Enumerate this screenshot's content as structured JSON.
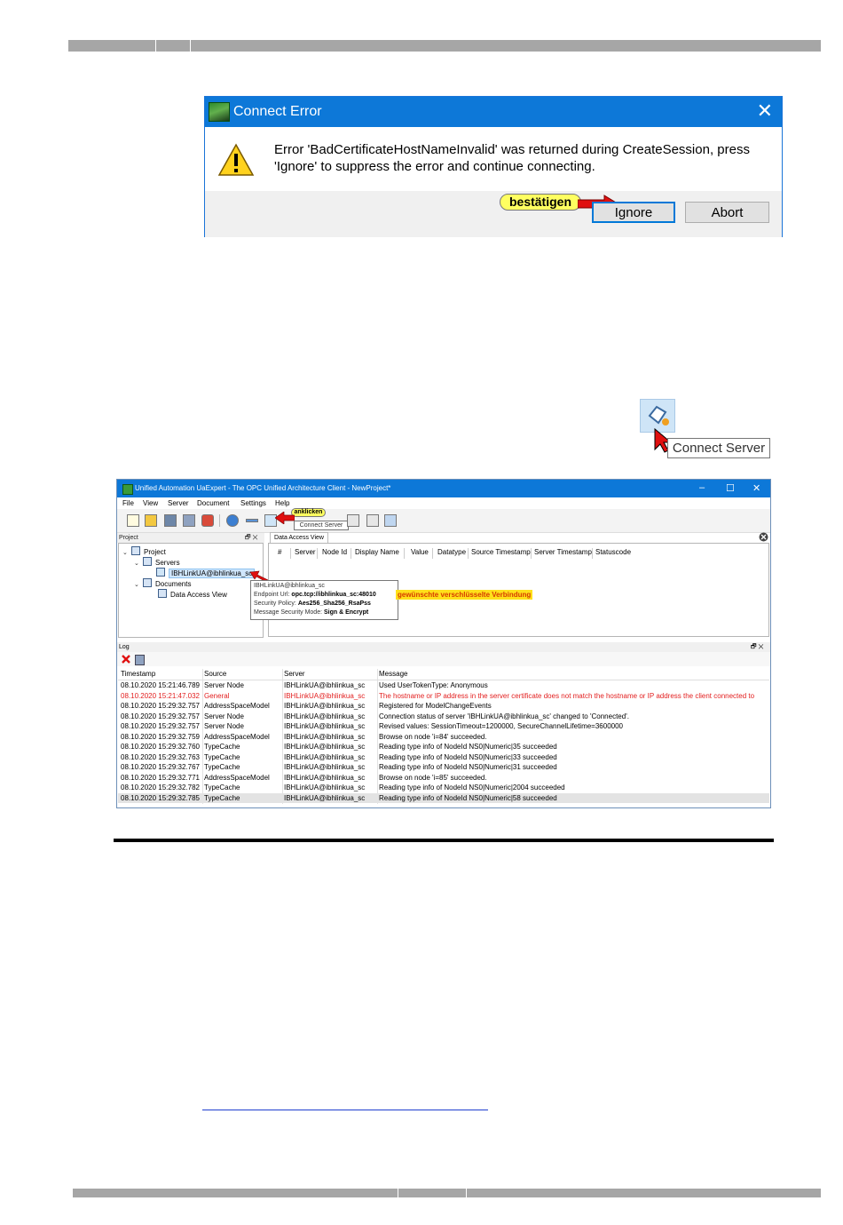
{
  "dialog": {
    "title": "Connect Error",
    "close_glyph": "✕",
    "message_line1": "Error 'BadCertificateHostNameInvalid' was returned during CreateSession, press",
    "message_line2": "'Ignore' to suppress the error and continue connecting.",
    "callout": "bestätigen",
    "ignore_label": "Ignore",
    "abort_label": "Abort"
  },
  "connect_server_tooltip": "Connect Server",
  "window": {
    "title": "Unified Automation UaExpert - The OPC Unified Architecture Client - NewProject*",
    "controls": {
      "min": "–",
      "max": "☐",
      "close": "✕"
    },
    "menu": [
      "File",
      "View",
      "Server",
      "Document",
      "Settings",
      "Help"
    ],
    "toolbar_callout": "anklicken",
    "toolbar_tooltip": "Connect Server",
    "project_pane": {
      "header": "Project",
      "header_controls": "🗗 ✕",
      "tree": {
        "project": "Project",
        "servers": "Servers",
        "server_item": "IBHLinkUA@ibhlinkua_sc",
        "documents": "Documents",
        "data_access_view": "Data Access View"
      }
    },
    "dav": {
      "tab": "Data Access View",
      "columns": [
        "#",
        "Server",
        "Node Id",
        "Display Name",
        "Value",
        "Datatype",
        "Source Timestamp",
        "Server Timestamp",
        "Statuscode"
      ]
    },
    "server_tooltip": {
      "name": "IBHLinkUA@ibhlinkua_sc",
      "endpoint_label": "Endpoint Url:",
      "endpoint": "opc.tcp://ibhlinkua_sc:48010",
      "policy_label": "Security Policy:",
      "policy": "Aes256_Sha256_RsaPss",
      "mode_label": "Message Security Mode:",
      "mode": "Sign & Encrypt",
      "callout": "gewünschte verschlüsselte Verbindung"
    },
    "log": {
      "header": "Log",
      "header_controls": "🗗 ✕",
      "columns": [
        "Timestamp",
        "Source",
        "Server",
        "Message"
      ],
      "rows": [
        {
          "t": "08.10.2020 15:21:46.789",
          "s": "Server Node",
          "srv": "IBHLinkUA@ibhlinkua_sc",
          "m": "Used UserTokenType: Anonymous"
        },
        {
          "t": "08.10.2020 15:21:47.032",
          "s": "General",
          "srv": "IBHLinkUA@ibhlinkua_sc",
          "m": "The hostname or IP address in the server certificate does not match the hostname or IP address the client connected to"
        },
        {
          "t": "08.10.2020 15:29:32.757",
          "s": "AddressSpaceModel",
          "srv": "IBHLinkUA@ibhlinkua_sc",
          "m": "Registered for ModelChangeEvents"
        },
        {
          "t": "08.10.2020 15:29:32.757",
          "s": "Server Node",
          "srv": "IBHLinkUA@ibhlinkua_sc",
          "m": "Connection status of server 'IBHLinkUA@ibhlinkua_sc' changed to 'Connected'."
        },
        {
          "t": "08.10.2020 15:29:32.757",
          "s": "Server Node",
          "srv": "IBHLinkUA@ibhlinkua_sc",
          "m": "Revised values: SessionTimeout=1200000, SecureChannelLifetime=3600000"
        },
        {
          "t": "08.10.2020 15:29:32.759",
          "s": "AddressSpaceModel",
          "srv": "IBHLinkUA@ibhlinkua_sc",
          "m": "Browse on node 'i=84' succeeded."
        },
        {
          "t": "08.10.2020 15:29:32.760",
          "s": "TypeCache",
          "srv": "IBHLinkUA@ibhlinkua_sc",
          "m": "Reading type info of NodeId NS0|Numeric|35 succeeded"
        },
        {
          "t": "08.10.2020 15:29:32.763",
          "s": "TypeCache",
          "srv": "IBHLinkUA@ibhlinkua_sc",
          "m": "Reading type info of NodeId NS0|Numeric|33 succeeded"
        },
        {
          "t": "08.10.2020 15:29:32.767",
          "s": "TypeCache",
          "srv": "IBHLinkUA@ibhlinkua_sc",
          "m": "Reading type info of NodeId NS0|Numeric|31 succeeded"
        },
        {
          "t": "08.10.2020 15:29:32.771",
          "s": "AddressSpaceModel",
          "srv": "IBHLinkUA@ibhlinkua_sc",
          "m": "Browse on node 'i=85' succeeded."
        },
        {
          "t": "08.10.2020 15:29:32.782",
          "s": "TypeCache",
          "srv": "IBHLinkUA@ibhlinkua_sc",
          "m": "Reading type info of NodeId NS0|Numeric|2004 succeeded"
        },
        {
          "t": "08.10.2020 15:29:32.785",
          "s": "TypeCache",
          "srv": "IBHLinkUA@ibhlinkua_sc",
          "m": "Reading type info of NodeId NS0|Numeric|58 succeeded"
        }
      ],
      "error_row_index": 1,
      "selected_row_index": 11
    }
  },
  "colors": {
    "title_blue": "#0d78d8",
    "callout_yellow": "#ffff60",
    "arrow_red": "#e01010",
    "error_text": "#e32020"
  }
}
